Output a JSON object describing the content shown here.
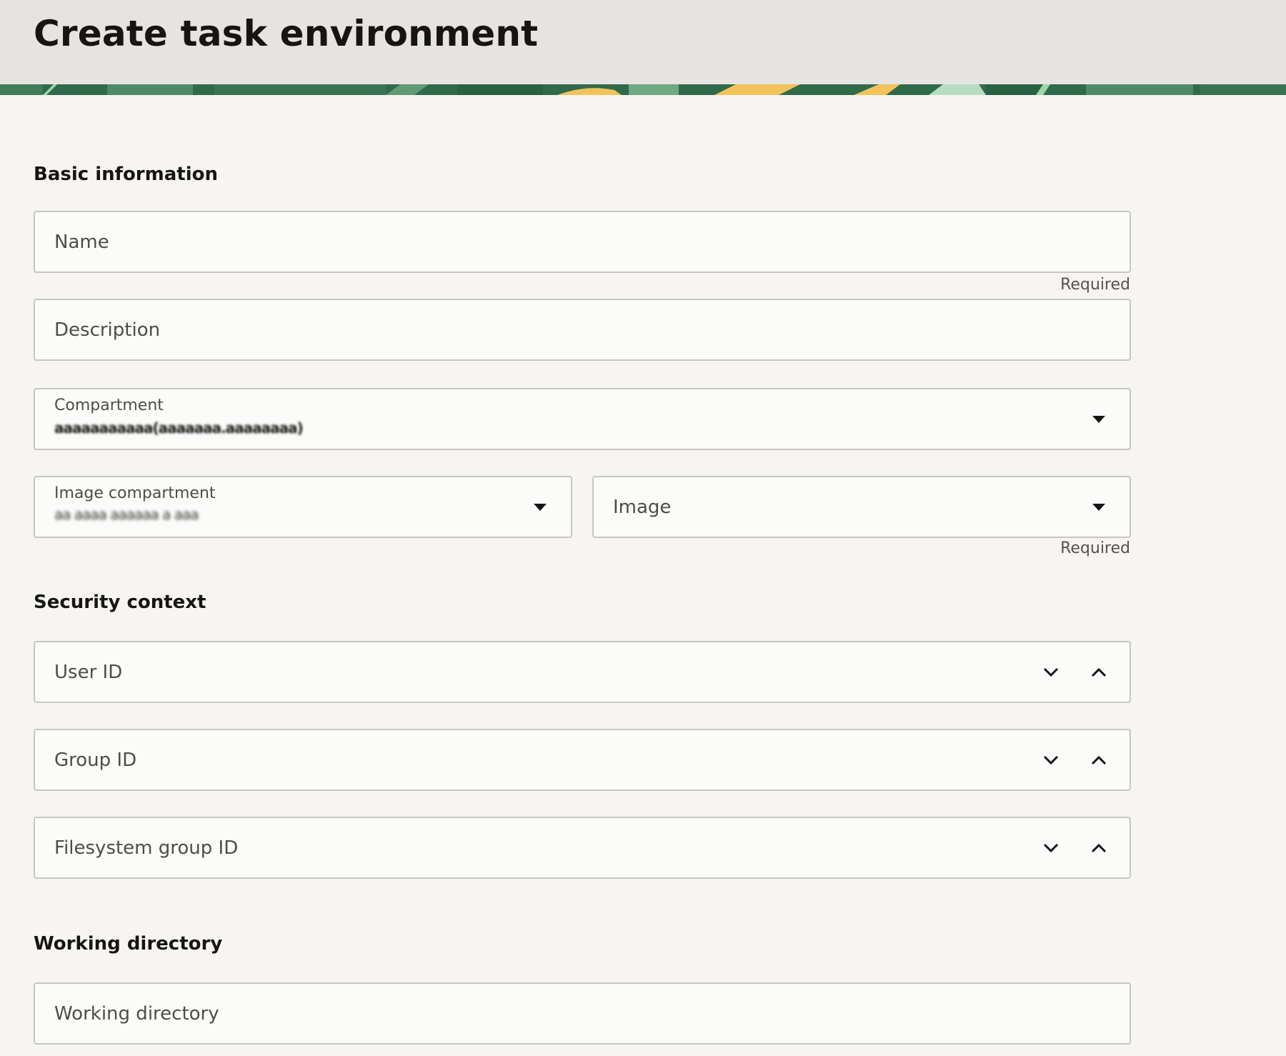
{
  "header": {
    "title": "Create task environment"
  },
  "sections": {
    "basic_information": "Basic information",
    "security_context": "Security context",
    "working_directory": "Working directory"
  },
  "fields": {
    "name": {
      "placeholder": "Name",
      "helper": "Required"
    },
    "description": {
      "placeholder": "Description"
    },
    "compartment": {
      "label": "Compartment",
      "value": "aaaaaaaaaaa(aaaaaaa.aaaaaaaa)",
      "icon": "caret-down-icon"
    },
    "image_compartment": {
      "label": "Image compartment",
      "value": "aa aaaa aaaaaa a       aaa",
      "icon": "caret-down-icon"
    },
    "image": {
      "placeholder": "Image",
      "helper": "Required",
      "icon": "caret-down-icon"
    },
    "user_id": {
      "placeholder": "User ID"
    },
    "group_id": {
      "placeholder": "Group ID"
    },
    "filesystem_group_id": {
      "placeholder": "Filesystem group ID"
    },
    "working_directory": {
      "placeholder": "Working directory"
    }
  },
  "colors": {
    "page_background": "#f6f5f3",
    "header_background": "#e6e4e1",
    "field_border": "#c8c6c3",
    "text_primary": "#161513",
    "banner_green": "#2f6b4a",
    "banner_yellow": "#f2c35a"
  }
}
